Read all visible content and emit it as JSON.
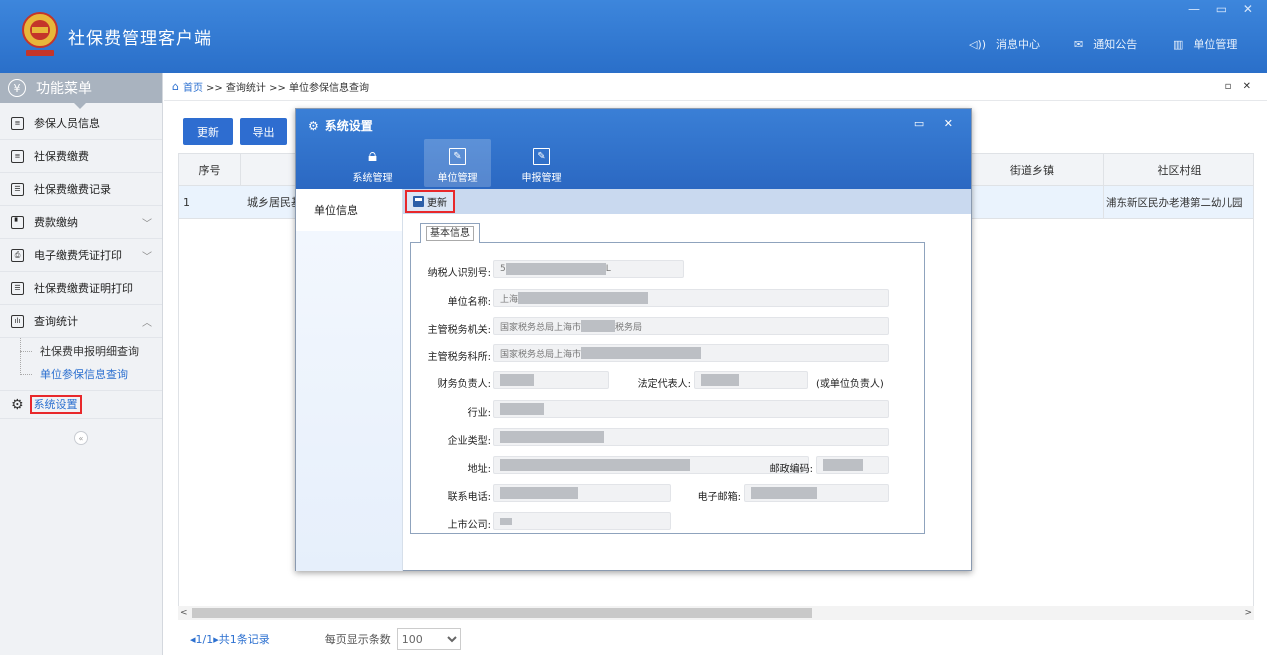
{
  "app": {
    "title": "社保费管理客户端",
    "window_controls": "— ▭ ✕",
    "nav": [
      {
        "icon": "speaker-icon",
        "label": "消息中心"
      },
      {
        "icon": "mail-icon",
        "label": "通知公告"
      },
      {
        "icon": "building-icon",
        "label": "单位管理"
      }
    ]
  },
  "sidebar": {
    "title": "功能菜单",
    "items": [
      {
        "label": "参保人员信息",
        "icon": "list-icon"
      },
      {
        "label": "社保费缴费",
        "icon": "list-icon"
      },
      {
        "label": "社保费缴费记录",
        "icon": "doc-icon"
      },
      {
        "label": "费款缴纳",
        "icon": "card-icon",
        "chevron": "﹀"
      },
      {
        "label": "电子缴费凭证打印",
        "icon": "printer-icon",
        "chevron": "﹀"
      },
      {
        "label": "社保费缴费证明打印",
        "icon": "doc-icon"
      },
      {
        "label": "查询统计",
        "icon": "chart-icon",
        "chevron": "︿"
      }
    ],
    "subitems": [
      "社保费申报明细查询",
      "单位参保信息查询"
    ],
    "system_setting": "系统设置",
    "collapse": "«"
  },
  "main": {
    "breadcrumb_home": "首页",
    "breadcrumb_rest": ">> 查询统计 >> 单位参保信息查询",
    "controls": "▫ ✕",
    "buttons": {
      "refresh": "更新",
      "export": "导出"
    },
    "columns": {
      "index": "序号",
      "street": "街道乡镇",
      "community": "社区村组"
    },
    "row": {
      "index": "1",
      "type": "城乡居民基",
      "community": "浦东新区民办老港第二幼儿园"
    },
    "pager": {
      "nav": "◂1/1▸共1条记录",
      "per_page_label": "每页显示条数",
      "per_page": "100"
    },
    "scroll_left": "<",
    "scroll_right": ">"
  },
  "modal": {
    "title": "系统设置",
    "controls": "▭ ✕",
    "tabs": [
      {
        "label": "系统管理",
        "icon": "lock-icon"
      },
      {
        "label": "单位管理",
        "icon": "edit-doc-icon"
      },
      {
        "label": "申报管理",
        "icon": "edit-doc-icon"
      }
    ],
    "left_item": "单位信息",
    "update_button": "更新",
    "section": "基本信息",
    "fields": {
      "taxpayer_id_label": "纳税人识别号:",
      "taxpayer_id": "5",
      "taxpayer_id_tail": "L",
      "name_label": "单位名称:",
      "name": "上海",
      "tax_authority_label": "主管税务机关:",
      "tax_authority_prefix": "国家税务总局上海市",
      "tax_authority_suffix": "税务局",
      "tax_office_label": "主管税务科所:",
      "tax_office_prefix": "国家税务总局上海市",
      "finance_label": "财务负责人:",
      "legal_label": "法定代表人:",
      "legal_note": "(或单位负责人)",
      "industry_label": "行业:",
      "enterprise_type_label": "企业类型:",
      "address_label": "地址:",
      "postcode_label": "邮政编码:",
      "phone_label": "联系电话:",
      "email_label": "电子邮箱:",
      "listed_label": "上市公司:"
    }
  }
}
